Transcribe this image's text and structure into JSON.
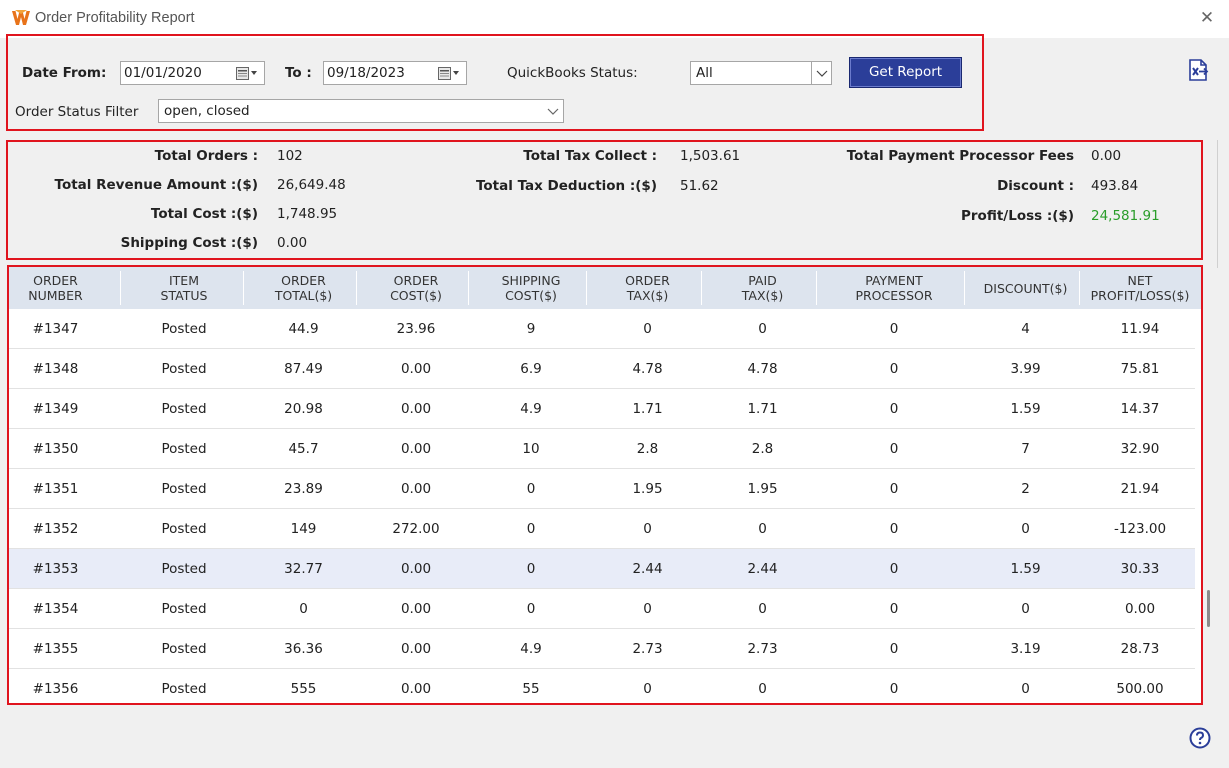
{
  "window": {
    "title": "Order Profitability Report",
    "logo_icon": "w-logo-icon",
    "close_label": "✕"
  },
  "filters": {
    "date_from_label": "Date From:",
    "date_from_value": "01/01/2020",
    "to_label": "To :",
    "to_value": "09/18/2023",
    "qb_status_label": "QuickBooks Status:",
    "qb_status_value": "All",
    "order_status_label": "Order Status Filter",
    "order_status_value": "open, closed",
    "get_report_label": "Get Report",
    "export_icon": "excel-export-icon"
  },
  "summary": {
    "total_orders_label": "Total Orders :",
    "total_orders_value": "102",
    "total_revenue_label": "Total Revenue Amount :($)",
    "total_revenue_value": "26,649.48",
    "total_cost_label": "Total Cost :($)",
    "total_cost_value": "1,748.95",
    "shipping_cost_label": "Shipping Cost :($)",
    "shipping_cost_value": "0.00",
    "total_tax_collect_label": "Total Tax Collect :",
    "total_tax_collect_value": "1,503.61",
    "total_tax_deduction_label": "Total Tax Deduction :($)",
    "total_tax_deduction_value": "51.62",
    "processor_fees_label": "Total Payment Processor Fees",
    "processor_fees_value": "0.00",
    "discount_label": "Discount :",
    "discount_value": "493.84",
    "profit_loss_label": "Profit/Loss :($)",
    "profit_loss_value": "24,581.91",
    "profit_color": "#2a9d2a"
  },
  "table": {
    "headers": [
      [
        "ORDER",
        "NUMBER"
      ],
      [
        "ITEM",
        "STATUS"
      ],
      [
        "ORDER",
        "TOTAL($)"
      ],
      [
        "ORDER",
        "COST($)"
      ],
      [
        "SHIPPING",
        "COST($)"
      ],
      [
        "ORDER",
        "TAX($)"
      ],
      [
        "PAID",
        "TAX($)"
      ],
      [
        "PAYMENT",
        "PROCESSOR"
      ],
      [
        "DISCOUNT($)"
      ],
      [
        "NET",
        "PROFIT/LOSS($)"
      ]
    ],
    "rows": [
      [
        "#1347",
        "Posted",
        "44.9",
        "23.96",
        "9",
        "0",
        "0",
        "0",
        "4",
        "11.94"
      ],
      [
        "#1348",
        "Posted",
        "87.49",
        "0.00",
        "6.9",
        "4.78",
        "4.78",
        "0",
        "3.99",
        "75.81"
      ],
      [
        "#1349",
        "Posted",
        "20.98",
        "0.00",
        "4.9",
        "1.71",
        "1.71",
        "0",
        "1.59",
        "14.37"
      ],
      [
        "#1350",
        "Posted",
        "45.7",
        "0.00",
        "10",
        "2.8",
        "2.8",
        "0",
        "7",
        "32.90"
      ],
      [
        "#1351",
        "Posted",
        "23.89",
        "0.00",
        "0",
        "1.95",
        "1.95",
        "0",
        "2",
        "21.94"
      ],
      [
        "#1352",
        "Posted",
        "149",
        "272.00",
        "0",
        "0",
        "0",
        "0",
        "0",
        "-123.00"
      ],
      [
        "#1353",
        "Posted",
        "32.77",
        "0.00",
        "0",
        "2.44",
        "2.44",
        "0",
        "1.59",
        "30.33"
      ],
      [
        "#1354",
        "Posted",
        "0",
        "0.00",
        "0",
        "0",
        "0",
        "0",
        "0",
        "0.00"
      ],
      [
        "#1355",
        "Posted",
        "36.36",
        "0.00",
        "4.9",
        "2.73",
        "2.73",
        "0",
        "3.19",
        "28.73"
      ],
      [
        "#1356",
        "Posted",
        "555",
        "0.00",
        "55",
        "0",
        "0",
        "0",
        "0",
        "500.00"
      ]
    ],
    "selected_row": 6
  },
  "help_icon": "help-icon"
}
